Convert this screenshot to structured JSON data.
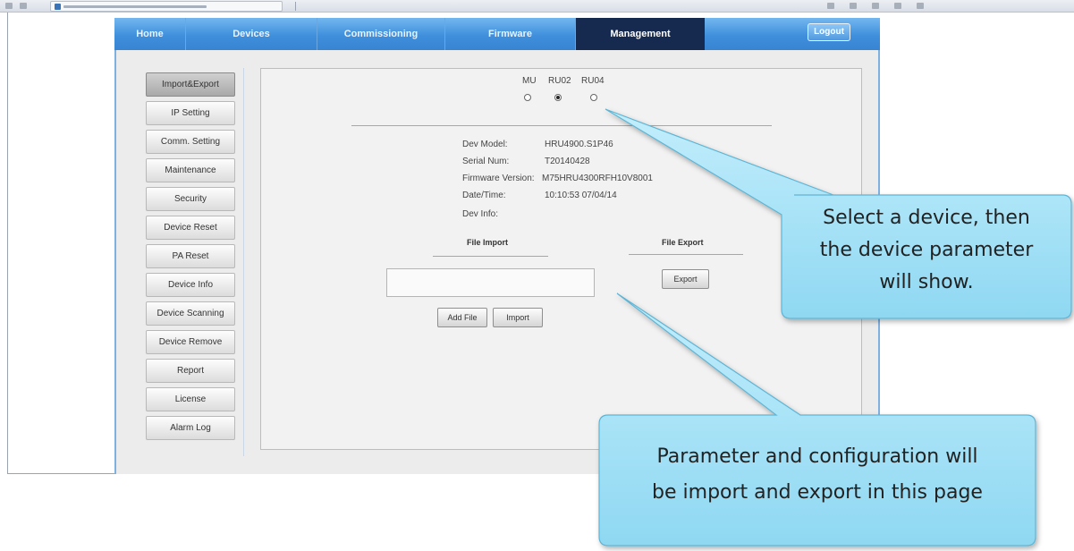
{
  "nav": {
    "items": [
      "Home",
      "Devices",
      "Commissioning",
      "Firmware",
      "Management"
    ],
    "active": "Management",
    "logout_label": "Logout",
    "bar_color": "#3f8fdc",
    "active_color": "#162a4f"
  },
  "menu": {
    "items": [
      "Import&Export",
      "IP Setting",
      "Comm. Setting",
      "Maintenance",
      "Security",
      "Device Reset",
      "PA Reset",
      "Device Info",
      "Device Scanning",
      "Device Remove",
      "Report",
      "License",
      "Alarm Log"
    ],
    "active": "Import&Export"
  },
  "devices": {
    "options": [
      "MU",
      "RU02",
      "RU04"
    ],
    "selected": "RU02"
  },
  "info": {
    "dev_model_label": "Dev Model:",
    "dev_model_value": "HRU4900.S1P46",
    "serial_label": "Serial Num:",
    "serial_value": "T20140428",
    "firmware_label": "Firmware Version:",
    "firmware_value": "M75HRU4300RFH10V8001",
    "datetime_label": "Date/Time:",
    "datetime_value": "10:10:53 07/04/14",
    "devinfo_label": "Dev Info:",
    "devinfo_value": ""
  },
  "file_import": {
    "title": "File Import",
    "path_value": "",
    "add_file_label": "Add File",
    "import_label": "Import"
  },
  "file_export": {
    "title": "File Export",
    "export_label": "Export"
  },
  "callouts": {
    "select_device": [
      "Select a device, then",
      "the device parameter",
      "will show."
    ],
    "import_export": [
      "Parameter and configuration will",
      "be import and export in this page"
    ],
    "fill_color": "#a9e3f7"
  }
}
